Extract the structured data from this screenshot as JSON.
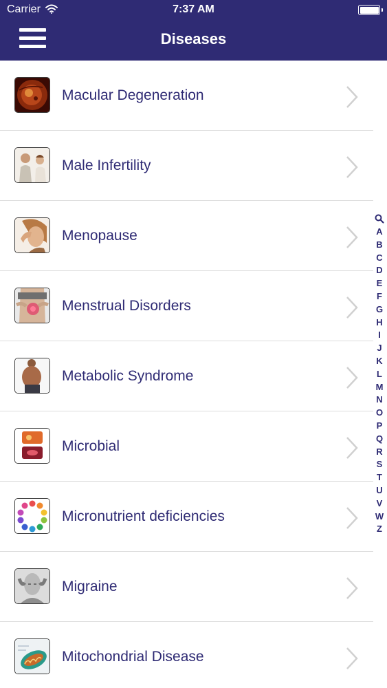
{
  "status_bar": {
    "carrier": "Carrier",
    "time": "7:37 AM"
  },
  "nav": {
    "title": "Diseases",
    "menu_icon": "hamburger-menu-icon"
  },
  "colors": {
    "nav_background": "#2f2b74",
    "label_text": "#2f2b74",
    "chevron": "#d0d0d0"
  },
  "list": {
    "items": [
      {
        "label": "Macular Degeneration",
        "thumbnail": "eye-retina-image"
      },
      {
        "label": "Male Infertility",
        "thumbnail": "couple-image"
      },
      {
        "label": "Menopause",
        "thumbnail": "woman-headache-image"
      },
      {
        "label": "Menstrual Disorders",
        "thumbnail": "abdomen-pain-image"
      },
      {
        "label": "Metabolic Syndrome",
        "thumbnail": "obese-man-image"
      },
      {
        "label": "Microbial",
        "thumbnail": "microbes-image"
      },
      {
        "label": "Micronutrient deficiencies",
        "thumbnail": "nutrient-circle-image"
      },
      {
        "label": "Migraine",
        "thumbnail": "migraine-image"
      },
      {
        "label": "Mitochondrial Disease",
        "thumbnail": "mitochondria-image"
      }
    ]
  },
  "index_bar": {
    "search_icon": "search-icon",
    "letters": [
      "A",
      "B",
      "C",
      "D",
      "E",
      "F",
      "G",
      "H",
      "I",
      "J",
      "K",
      "L",
      "M",
      "N",
      "O",
      "P",
      "Q",
      "R",
      "S",
      "T",
      "U",
      "V",
      "W",
      "Z"
    ]
  }
}
